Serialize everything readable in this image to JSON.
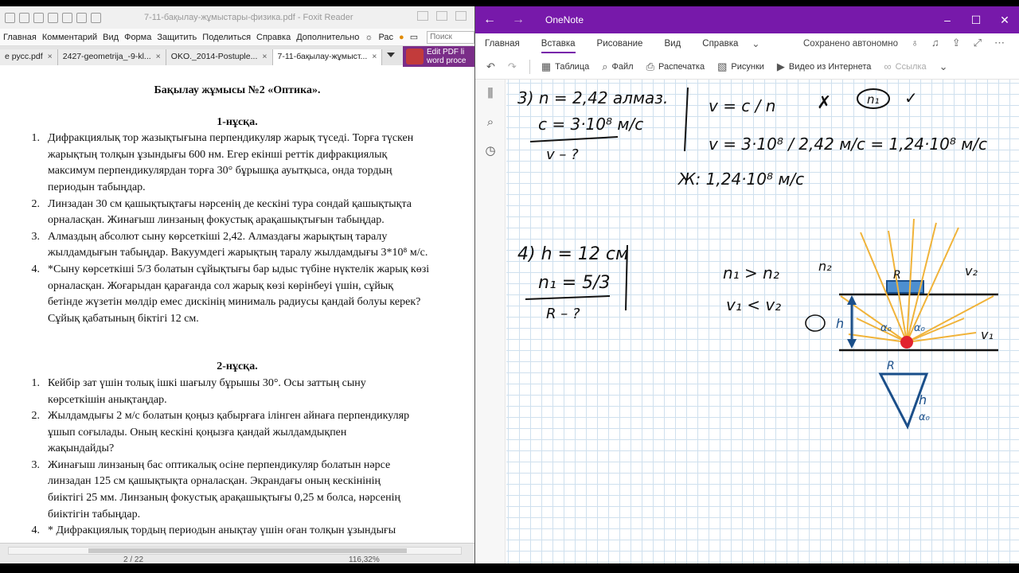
{
  "foxit": {
    "title": "7-11-бақылау-жұмыстары-физика.pdf - Foxit Reader",
    "menu": [
      "Главная",
      "Комментарий",
      "Вид",
      "Форма",
      "Защитить",
      "Поделиться",
      "Справка",
      "Дополнительно"
    ],
    "menu_extra": "Рас",
    "search_placeholder": "Поиск",
    "tabs": [
      {
        "label": "е русс.pdf",
        "active": false
      },
      {
        "label": "2427-geometrija_-9-kl...",
        "active": false
      },
      {
        "label": "OKO._2014-Postuple...",
        "active": false
      },
      {
        "label": "7-11-бақылау-жұмыст...",
        "active": true
      }
    ],
    "ad_line1": "Edit PDF li",
    "ad_line2": "word proce",
    "doc": {
      "title": "Бақылау жұмысы №2 «Оптика».",
      "variant1": "1-нұсқа.",
      "v1_items": [
        {
          "n": "1.",
          "text": "Дифракциялық тор жазықтығына  перпендикуляр жарық түседі. Торға түскен\nжарықтың толқын ұзындығы 600 нм. Егер екінші реттік дифракциялық\nмаксимум перпендикулярдан торға 30° бұрышқа ауытқыса, онда тордың\nпериодын табыңдар."
        },
        {
          "n": "2.",
          "text": "Линзадан 30 см қашықтықтағы нәрсенің де кескіні тура сондай қашықтықта\nорналасқан. Жинағыш линзаның фокустық арақашықтығын табыңдар."
        },
        {
          "n": "3.",
          "text": "Алмаздың абсолют сыну көрсеткіші 2,42. Алмаздағы жарықтың таралу\nжылдамдығын табыңдар. Вакуумдегі жарықтың таралу жылдамдығы 3*10⁸ м/с."
        },
        {
          "n": "4.",
          "text": "*Сыну көрсеткіші 5/3 болатын сұйықтығы бар ыдыс түбіне нүктелік жарық көзі\nорналасқан. Жоғарыдан қарағанда сол жарық көзі көрінбеуі үшін, сұйық\nбетінде жүзетін мөлдір емес дискінің минималь радиусы қандай болуы керек?\nСұйық қабатының біктігі 12 см."
        }
      ],
      "variant2": "2-нұсқа.",
      "v2_items": [
        {
          "n": "1.",
          "text": "Кейбір зат үшін толық ішкі шағылу бұрышы 30°. Осы заттың сыну\nкөрсеткішін анықтаңдар."
        },
        {
          "n": "2.",
          "text": "Жылдамдығы 2 м/с болатын қоңыз қабырғаға ілінген айнаға перпендикуляр\nұшып соғылады. Оның кескіні қоңызға қандай жылдамдықпен\nжақындайды?"
        },
        {
          "n": "3.",
          "text": "Жинағыш линзаның бас оптикалық осіне перпендикуляр болатын нәрсе\nлинзадан 125 см қашықтықта орналасқан. Экрандағы оның кескінінің\nбиіктігі 25 мм. Линзаның фокустық арақашықтығы 0,25 м болса, нәрсенің\nбиіктігін табыңдар."
        },
        {
          "n": "4.",
          "text": "* Дифракциялық тордың периодын анықтау үшін оған толқын ұзындығы"
        }
      ]
    },
    "status": {
      "page": "2 / 22",
      "zoom": "116,32%"
    }
  },
  "onenote": {
    "app_name": "OneNote",
    "tabs": [
      {
        "label": "Главная",
        "active": false
      },
      {
        "label": "Вставка",
        "active": true
      },
      {
        "label": "Рисование",
        "active": false
      },
      {
        "label": "Вид",
        "active": false
      },
      {
        "label": "Справка",
        "active": false
      }
    ],
    "saved_status": "Сохранено автономно",
    "ribbon": [
      {
        "label": "Таблица",
        "icon": "table-icon"
      },
      {
        "label": "Файл",
        "icon": "paperclip-icon"
      },
      {
        "label": "Распечатка",
        "icon": "printout-icon"
      },
      {
        "label": "Рисунки",
        "icon": "picture-icon"
      },
      {
        "label": "Видео из Интернета",
        "icon": "video-icon"
      }
    ],
    "ribbon_disabled": "Ссылка",
    "ink": {
      "p3_n": "3)  n = 2,42  алмаз.",
      "p3_c": "c = 3·10⁸ м/с",
      "p3_find": "v – ?",
      "p3_f1": "v = c / n",
      "p3_f2": "v = 3·10⁸ / 2,42 м/с = 1,24·10⁸ м/с",
      "p3_ans": "Ж:  1,24·10⁸ м/с",
      "p4_h": "4)  h = 12 см",
      "p4_n": "n₁ = 5/3",
      "p4_find": "R – ?",
      "p4_ineq1": "n₁ > n₂",
      "p4_ineq2": "v₁ < v₂",
      "lbl_n2": "n₂",
      "lbl_n1": "n₁",
      "lbl_v1": "v₁",
      "lbl_v2": "v₂",
      "lbl_R": "R",
      "lbl_h": "h",
      "lbl_a": "α₀"
    }
  }
}
